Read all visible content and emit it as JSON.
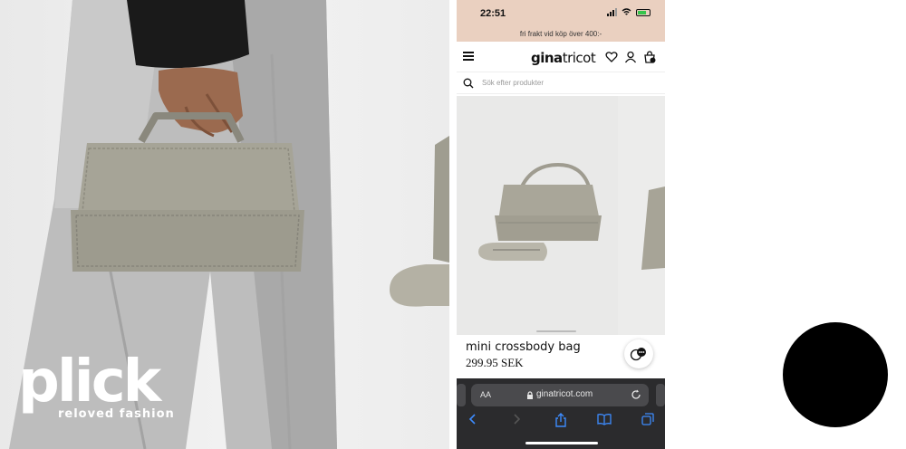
{
  "plick": {
    "wordmark": "plick",
    "tagline": "reloved fashion"
  },
  "phone": {
    "status": {
      "time": "22:51"
    },
    "promo_text": "fri frakt vid köp över 400:-",
    "brand": {
      "bold": "gina",
      "regular": "tricot"
    },
    "search": {
      "placeholder": "Sök efter produkter"
    },
    "product": {
      "name": "mini crossbody bag",
      "price": "299.95 SEK"
    },
    "browser": {
      "aa_label": "AA",
      "url": "ginatricot.com"
    }
  },
  "colors": {
    "promo_bg": "#ead0c0",
    "browser_bg": "#2b2b2d",
    "safari_blue": "#3d8bfd",
    "circle": "#000000"
  },
  "icons": [
    "menu-icon",
    "heart-icon",
    "user-icon",
    "cart-icon",
    "search-icon",
    "chat-icon",
    "lock-icon",
    "reload-icon",
    "back-icon",
    "forward-icon",
    "share-icon",
    "bookmarks-icon",
    "tabs-icon"
  ]
}
